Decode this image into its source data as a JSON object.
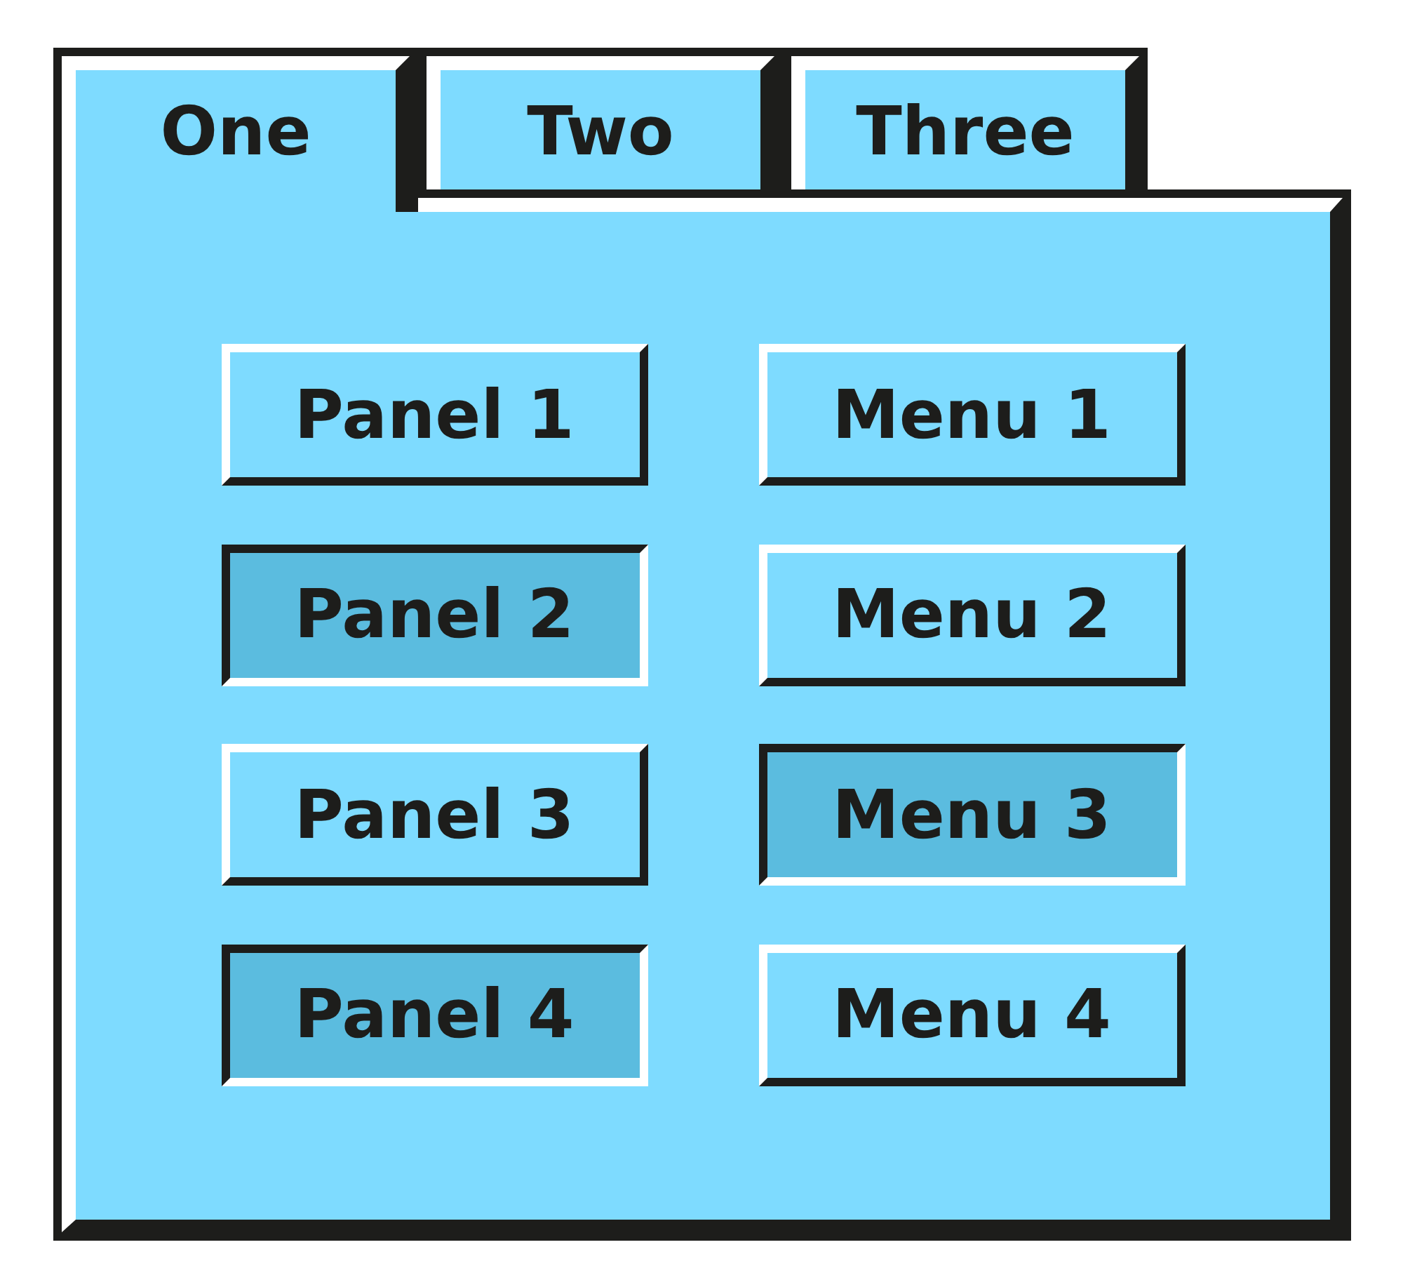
{
  "tabs": [
    {
      "label": "One",
      "selected": true
    },
    {
      "label": "Two",
      "selected": false
    },
    {
      "label": "Three",
      "selected": false
    }
  ],
  "panel_buttons": [
    {
      "label": "Panel 1",
      "pressed": false
    },
    {
      "label": "Panel 2",
      "pressed": true
    },
    {
      "label": "Panel 3",
      "pressed": false
    },
    {
      "label": "Panel 4",
      "pressed": true
    }
  ],
  "menu_buttons": [
    {
      "label": "Menu 1",
      "pressed": false
    },
    {
      "label": "Menu 2",
      "pressed": false
    },
    {
      "label": "Menu 3",
      "pressed": true
    },
    {
      "label": "Menu 4",
      "pressed": false
    }
  ]
}
